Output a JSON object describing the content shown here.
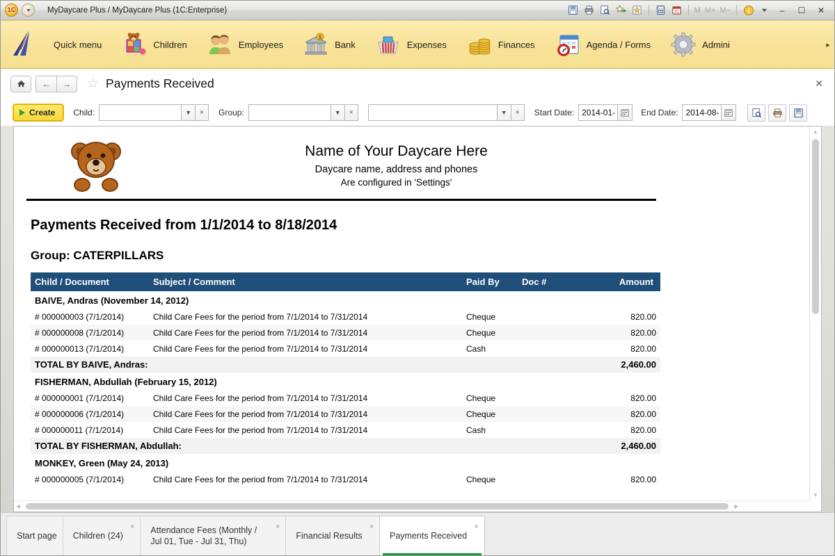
{
  "titlebar": {
    "title": "MyDaycare Plus / MyDaycare Plus  (1C:Enterprise)",
    "app_icon": "1c-logo-icon",
    "icons": [
      {
        "name": "save-icon",
        "glyph": "▤"
      },
      {
        "name": "print-icon",
        "glyph": "⎙"
      },
      {
        "name": "print-preview-icon",
        "glyph": "⌕"
      },
      {
        "name": "add-favorite-icon",
        "glyph": "☆"
      },
      {
        "name": "favorites-icon",
        "glyph": "★"
      },
      {
        "name": "calculator-icon",
        "glyph": "⊞"
      },
      {
        "name": "calendar-icon",
        "glyph": "31"
      }
    ],
    "memory": [
      "M",
      "M+",
      "M−"
    ],
    "info_label": "i",
    "minimize": "–",
    "maximize": "☐",
    "close": "✕"
  },
  "nav": {
    "items": [
      {
        "label": "Quick menu",
        "icon": "quick-menu-icon"
      },
      {
        "label": "Children",
        "icon": "children-toybox-icon"
      },
      {
        "label": "Employees",
        "icon": "employees-people-icon"
      },
      {
        "label": "Bank",
        "icon": "bank-building-icon"
      },
      {
        "label": "Expenses",
        "icon": "expenses-basket-icon"
      },
      {
        "label": "Finances",
        "icon": "finances-coins-icon"
      },
      {
        "label": "Agenda / Forms",
        "icon": "agenda-calendar-icon"
      },
      {
        "label": "Admini",
        "icon": "administration-gear-icon"
      }
    ],
    "more": "▸"
  },
  "formheader": {
    "home": "⌂",
    "back": "←",
    "forward": "→",
    "favorite_star": "☆",
    "title": "Payments Received",
    "close": "✕"
  },
  "toolbar": {
    "create_label": "Create",
    "child_label": "Child:",
    "child_value": "",
    "group_label": "Group:",
    "group_value": "",
    "extra_value": "",
    "start_date_label": "Start Date:",
    "start_date_value": "2014-01-",
    "end_date_label": "End Date:",
    "end_date_value": "2014-08-",
    "arrow_glyph": "▼",
    "clear_glyph": "×",
    "calendar_glyph": "▦",
    "actions": [
      {
        "name": "print-preview-button",
        "glyph": "⌕"
      },
      {
        "name": "print-button",
        "glyph": "⎙"
      },
      {
        "name": "save-button",
        "glyph": "▤"
      }
    ]
  },
  "report": {
    "logo": "teddy-bear-logo",
    "company_name": "Name of Your Daycare Here",
    "company_line2": "Daycare name, address and phones",
    "company_line3": "Are configured in 'Settings'",
    "title": "Payments Received from 1/1/2014 to 8/18/2014",
    "group_line": "Group: CATERPILLARS",
    "columns": [
      "Child / Document",
      "Subject / Comment",
      "Paid By",
      "Doc #",
      "Amount"
    ],
    "rows": [
      {
        "type": "child",
        "label": "BAIVE, Andras (November 14, 2012)"
      },
      {
        "type": "data",
        "doc": "# 000000003 (7/1/2014)",
        "subject": "Child Care Fees for the period from 7/1/2014 to 7/31/2014",
        "paid_by": "Cheque",
        "docnum": "",
        "amount": "820.00"
      },
      {
        "type": "data",
        "doc": "# 000000008 (7/1/2014)",
        "subject": "Child Care Fees for the period from 7/1/2014 to 7/31/2014",
        "paid_by": "Cheque",
        "docnum": "",
        "amount": "820.00"
      },
      {
        "type": "data",
        "doc": "# 000000013 (7/1/2014)",
        "subject": "Child Care Fees for the period from 7/1/2014 to 7/31/2014",
        "paid_by": "Cash",
        "docnum": "",
        "amount": "820.00"
      },
      {
        "type": "total",
        "label": "TOTAL BY BAIVE, Andras:",
        "amount": "2,460.00"
      },
      {
        "type": "child",
        "label": "FISHERMAN, Abdullah (February 15, 2012)"
      },
      {
        "type": "data",
        "doc": "# 000000001 (7/1/2014)",
        "subject": "Child Care Fees for the period from 7/1/2014 to 7/31/2014",
        "paid_by": "Cheque",
        "docnum": "",
        "amount": "820.00"
      },
      {
        "type": "data",
        "doc": "# 000000006 (7/1/2014)",
        "subject": "Child Care Fees for the period from 7/1/2014 to 7/31/2014",
        "paid_by": "Cheque",
        "docnum": "",
        "amount": "820.00"
      },
      {
        "type": "data",
        "doc": "# 000000011 (7/1/2014)",
        "subject": "Child Care Fees for the period from 7/1/2014 to 7/31/2014",
        "paid_by": "Cash",
        "docnum": "",
        "amount": "820.00"
      },
      {
        "type": "total",
        "label": "TOTAL BY FISHERMAN, Abdullah:",
        "amount": "2,460.00"
      },
      {
        "type": "child",
        "label": "MONKEY, Green (May 24, 2013)"
      },
      {
        "type": "data",
        "doc": "# 000000005 (7/1/2014)",
        "subject": "Child Care Fees for the period from 7/1/2014 to 7/31/2014",
        "paid_by": "Cheque",
        "docnum": "",
        "amount": "820.00"
      }
    ]
  },
  "tabs": [
    {
      "label": "Start page",
      "closable": false,
      "active": false
    },
    {
      "label": "Children (24)",
      "closable": true,
      "active": false
    },
    {
      "label": "Attendance Fees (Monthly / Jul 01, Tue - Jul 31, Thu)",
      "closable": true,
      "active": false
    },
    {
      "label": "Financial Results",
      "closable": true,
      "active": false
    },
    {
      "label": "Payments Received",
      "closable": true,
      "active": true
    }
  ],
  "colors": {
    "nav_bg": "#f8e39a",
    "table_header": "#1f4e79",
    "create_button": "#f6d93c",
    "active_tab_underline": "#169c3c"
  }
}
